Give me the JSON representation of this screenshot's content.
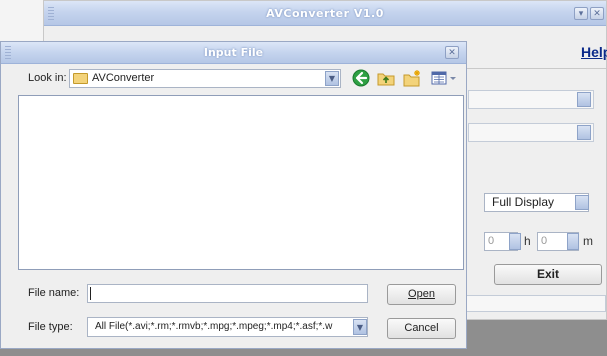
{
  "main_window": {
    "title": "AVConverter V1.0",
    "help_link": "Help",
    "display_mode_value": "Full Display",
    "hours_value": "0",
    "hours_unit": "h",
    "minutes_value": "0",
    "minutes_unit": "m",
    "exit_label": "Exit",
    "partial_label": ":"
  },
  "dialog": {
    "title": "Input File",
    "look_in_label": "Look in:",
    "look_in_value": "AVConverter",
    "file_name_label": "File name:",
    "file_name_value": "",
    "file_type_label": "File type:",
    "file_type_value": "All File(*.avi;*.rm;*.rmvb;*.mpg;*.mpeg;*.mp4;*.asf;*.w",
    "open_label": "Open",
    "cancel_label": "Cancel",
    "toolbar_icons": [
      "back-icon",
      "up-folder-icon",
      "new-folder-icon",
      "view-menu-icon"
    ]
  },
  "colors": {
    "title_bar": "#c5d4ee",
    "help_link": "#0b2a8a",
    "back_icon": "#2ea043"
  }
}
